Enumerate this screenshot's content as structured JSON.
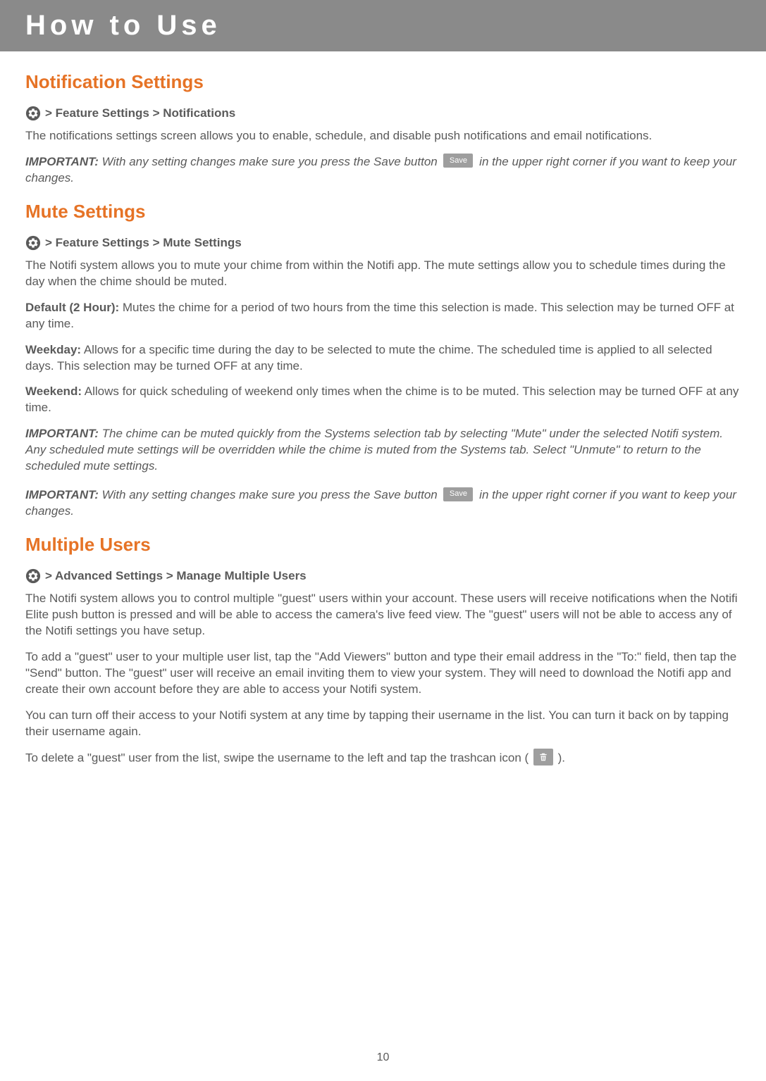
{
  "banner": {
    "title": "How to Use"
  },
  "page_number": "10",
  "icons": {
    "save_label": "Save"
  },
  "sections": {
    "notif": {
      "heading": "Notification Settings",
      "breadcrumb": " > Feature Settings > Notifications",
      "p1": "The notifications settings screen allows you to enable, schedule, and disable push notifications and email notifications.",
      "imp_lbl": "IMPORTANT:",
      "imp_a": " With any setting changes make sure you press the Save button ",
      "imp_b": " in the upper right corner if you want to keep your changes."
    },
    "mute": {
      "heading": "Mute Settings",
      "breadcrumb": " > Feature Settings > Mute Settings",
      "p1": "The Notifi system allows you to mute your chime from within the Notifi app. The mute settings allow you to schedule times during the day when the chime should be muted.",
      "def_lbl": "Default (2 Hour):",
      "def_txt": " Mutes the chime for a period of two hours from the time this selection is made. This selection may be turned OFF at any time.",
      "wkday_lbl": "Weekday:",
      "wkday_txt": " Allows for a specific time during the day to be selected to mute the chime. The scheduled time is applied to all selected days. This selection may be turned OFF at any time.",
      "wkend_lbl": "Weekend:",
      "wkend_txt": " Allows for quick scheduling of weekend only times when the chime is to be muted. This selection may be turned OFF at any time.",
      "imp1_lbl": "IMPORTANT:",
      "imp1_txt": " The chime can be muted quickly from the Systems selection tab by selecting \"Mute\" under the selected Notifi system. Any scheduled mute settings will be overridden while the chime is muted from the Systems tab. Select \"Unmute\" to return to the scheduled mute settings.",
      "imp2_lbl": "IMPORTANT:",
      "imp2_a": " With any setting changes make sure you press the Save button ",
      "imp2_b": " in the upper right corner if you want to keep your changes."
    },
    "users": {
      "heading": "Multiple Users",
      "breadcrumb": " > Advanced Settings > Manage Multiple Users",
      "p1": "The Notifi system allows you to control multiple \"guest\" users within your account. These users will receive notifications when the Notifi Elite push button is pressed and will be able to access the camera's live feed view. The \"guest\" users will not be able to access any of the Notifi settings you have setup.",
      "p2": "To add a \"guest\" user to your multiple user list, tap the \"Add Viewers\" button and type their email address in the \"To:\" field, then tap the \"Send\" button. The \"guest\" user will receive an email inviting them to view your system. They will need to download the Notifi app and create their own account before they are able to access your Notifi system.",
      "p3": "You can turn off their access to your Notifi system at any time by tapping their username in the list. You can turn it back on by tapping their username again.",
      "p4a": "To delete a \"guest\" user from the list, swipe the username to the left and tap the trashcan icon ( ",
      "p4b": " )."
    }
  }
}
